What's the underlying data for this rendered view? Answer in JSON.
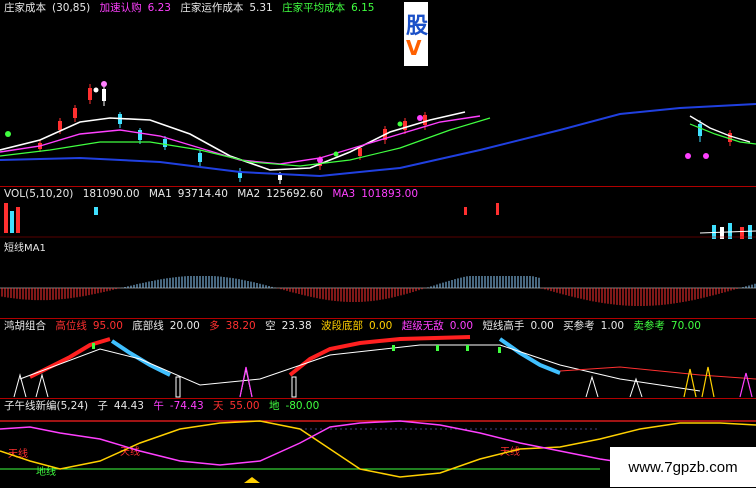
{
  "main_header": {
    "cost1_label": "庄家成本",
    "cost1_param": "(30,85)",
    "accum_label": "加速认购",
    "accum_val": "6.23",
    "op_label": "庄家运作成本",
    "op_val": "5.31",
    "avg_label": "庄家平均成本",
    "avg_val": "6.15"
  },
  "logo": {
    "line1": "股",
    "line2": "V"
  },
  "vol_header": {
    "title": "VOL(5,10,20)",
    "vol_val": "181090.00",
    "ma1_label": "MA1",
    "ma1_val": "93714.40",
    "ma2_label": "MA2",
    "ma2_val": "125692.60",
    "ma3_label": "MA3",
    "ma3_val": "101893.00"
  },
  "vol_side_label": "短线MA1",
  "signal_header": {
    "name": "鸿胡组合",
    "high": "高位线",
    "high_val": "95.00",
    "bottom": "底部线",
    "bottom_val": "20.00",
    "long": "多",
    "long_val": "38.20",
    "short": "空",
    "short_val": "23.38",
    "wave": "波段底部",
    "wave_val": "0.00",
    "unrivaled": "超级无敌",
    "unrivaled_val": "0.00",
    "short_high": "短线高手",
    "short_high_val": "0.00",
    "buy": "买参考",
    "buy_val": "1.00",
    "sell": "卖参考",
    "sell_val": "70.00"
  },
  "osc_header": {
    "name": "子午线新编(5,24)",
    "zi": "子",
    "zi_val": "44.43",
    "wu": "午",
    "wu_val": "-74.43",
    "tian": "天",
    "tian_val": "55.00",
    "di": "地",
    "di_val": "-80.00"
  },
  "osc_labels": {
    "tianxian": "天线",
    "dixian": "地线",
    "left_mid": "地",
    "mid1": "天线",
    "mid2": "天线"
  },
  "watermark": "www.7gpzb.com",
  "colors": {
    "grid": "#b00000",
    "up": "#ff3030",
    "down": "#40e0ff",
    "bg": "#000000"
  }
}
